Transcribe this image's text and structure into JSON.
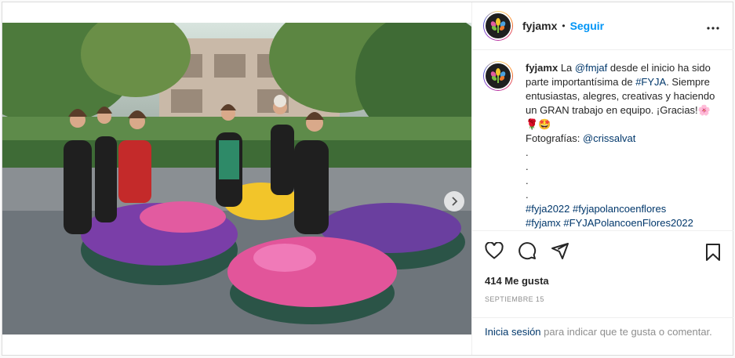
{
  "post": {
    "username": "fyjamx",
    "separator": "•",
    "follow_label": "Seguir",
    "more_icon": "more-horizontal-icon",
    "caption": {
      "username": "fyjamx",
      "part1": " La ",
      "mention1": "@fmjaf",
      "part2": " desde el inicio ha sido parte importantísima de ",
      "hashtag1": "#FYJA",
      "part3": ". Siempre entusiastas, alegres, creativas y haciendo un GRAN trabajo en equipo. ¡Gracias!",
      "emojis": "🌸🌹🤩",
      "part4": "Fotografías: ",
      "mention2": "@crissalvat",
      "dot_lines": [
        ".",
        ".",
        ".",
        "."
      ],
      "hashtags_line1": "#fyja2022 #fyjapolancoenflores",
      "hashtags_line2": "#fyjamx #FYJAPolancoenFlores2022"
    },
    "likes": "414 Me gusta",
    "date": "SEPTIEMBRE 15",
    "login_link": "Inicia sesión",
    "login_text": " para indicar que te gusta o comentar.",
    "carousel": {
      "total": 4,
      "active": 0
    }
  },
  "icons": [
    "like-icon",
    "comment-icon",
    "share-icon",
    "save-icon",
    "carousel-next-icon"
  ]
}
